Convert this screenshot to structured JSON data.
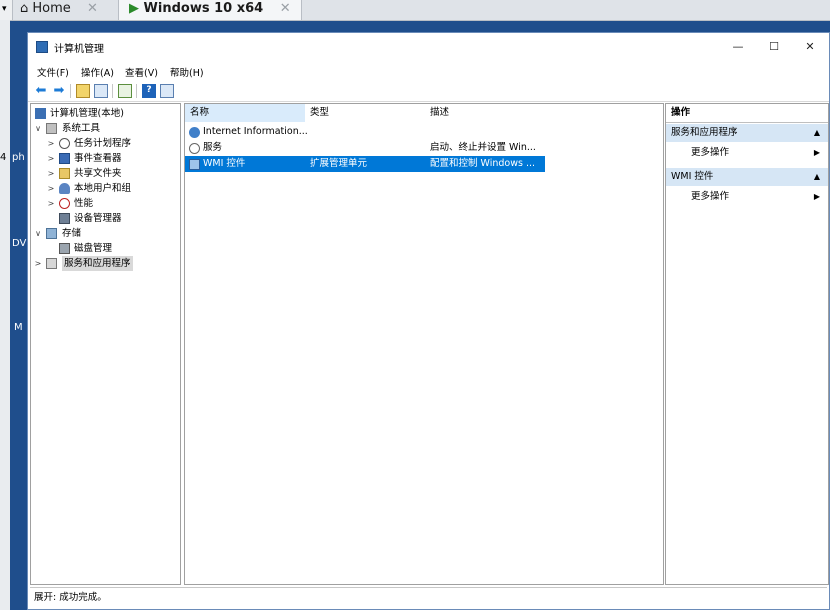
{
  "vm_tabs": {
    "home_label": "Home",
    "active_label": "Windows 10 x64"
  },
  "desktop": {
    "fragments": [
      "4",
      "ph",
      "DV",
      "M"
    ]
  },
  "window": {
    "title": "计算机管理",
    "buttons": {
      "minimize": "—",
      "maximize": "☐",
      "close": "✕"
    }
  },
  "menubar": {
    "items": [
      "文件(F)",
      "操作(A)",
      "查看(V)",
      "帮助(H)"
    ]
  },
  "tree": {
    "items": [
      {
        "label": "计算机管理(本地)",
        "chevron": ""
      },
      {
        "label": "系统工具",
        "chevron": "∨"
      },
      {
        "label": "任务计划程序",
        "chevron": ">"
      },
      {
        "label": "事件查看器",
        "chevron": ">"
      },
      {
        "label": "共享文件夹",
        "chevron": ">"
      },
      {
        "label": "本地用户和组",
        "chevron": ">"
      },
      {
        "label": "性能",
        "chevron": ">"
      },
      {
        "label": "设备管理器",
        "chevron": ""
      },
      {
        "label": "存储",
        "chevron": "∨"
      },
      {
        "label": "磁盘管理",
        "chevron": ""
      },
      {
        "label": "服务和应用程序",
        "chevron": ">"
      }
    ]
  },
  "list": {
    "columns": [
      "名称",
      "类型",
      "描述"
    ],
    "rows": [
      {
        "name": "Internet Information...",
        "type": "",
        "desc": ""
      },
      {
        "name": "服务",
        "type": "",
        "desc": "启动、终止并设置 Win..."
      },
      {
        "name": "WMI 控件",
        "type": "扩展管理单元",
        "desc": "配置和控制 Windows ..."
      }
    ]
  },
  "actions": {
    "header": "操作",
    "sections": [
      {
        "title": "服务和应用程序",
        "more": "更多操作"
      },
      {
        "title": "WMI 控件",
        "more": "更多操作"
      }
    ]
  },
  "status": {
    "text": "展开: 成功完成。"
  },
  "colors": {
    "selection": "#0078d7",
    "section_bg": "#d6e6f5"
  }
}
